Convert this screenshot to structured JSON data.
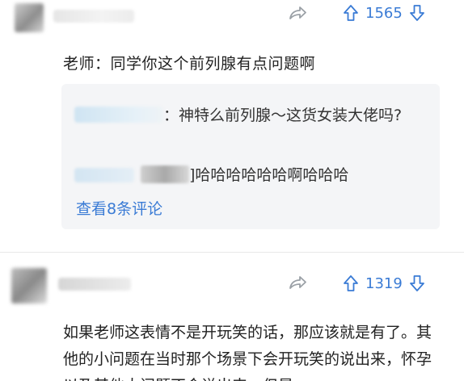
{
  "comments": [
    {
      "upvotes": "1565",
      "text": "老师：同学你这个前列腺有点问题啊",
      "replies": [
        {
          "text": "：神特么前列腺～这货女装大佬吗?"
        },
        {
          "text": "]哈哈哈哈哈哈啊哈哈哈"
        }
      ],
      "view_more": "查看8条评论"
    },
    {
      "upvotes": "1319",
      "text": "如果老师这表情不是开玩笑的话，那应该就是有了。其他的小问题在当时那个场景下会开玩笑的说出来，怀孕以及其他大问题不会说出来，但是"
    }
  ],
  "colors": {
    "accent": "#3a7bd5",
    "icon_gray": "#9aa0a6",
    "reply_bg": "#f4f5f7"
  },
  "icons": {
    "share": "share-arrow-icon",
    "upvote": "upvote-arrow-icon",
    "downvote": "downvote-arrow-icon"
  }
}
